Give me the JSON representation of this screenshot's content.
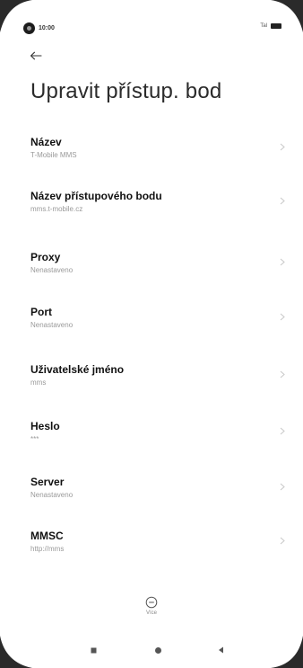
{
  "status_bar": {
    "time": "10:00",
    "signal_text": "Tal"
  },
  "header": {
    "back_icon": "arrow-left-icon",
    "title": "Upravit přístup. bod"
  },
  "settings": [
    {
      "label": "Název",
      "value": "T-Mobile MMS"
    },
    {
      "label": "Název přístupového bodu",
      "value": "mms.t-mobile.cz"
    },
    {
      "label": "Proxy",
      "value": "Nenastaveno"
    },
    {
      "label": "Port",
      "value": "Nenastaveno"
    },
    {
      "label": "Uživatelské jméno",
      "value": "mms"
    },
    {
      "label": "Heslo",
      "value": "***"
    },
    {
      "label": "Server",
      "value": "Nenastaveno"
    },
    {
      "label": "MMSC",
      "value": "http://mms"
    }
  ],
  "more": {
    "icon": "more-circle-icon",
    "label": "Více"
  },
  "nav_bar": {
    "recents_icon": "square-icon",
    "home_icon": "circle-icon",
    "back_icon": "triangle-back-icon"
  },
  "colors": {
    "background": "#ffffff",
    "title": "#2b2b2b",
    "label": "#111111",
    "secondary": "#9a9a9a",
    "bezel": "#2a2a2a"
  }
}
